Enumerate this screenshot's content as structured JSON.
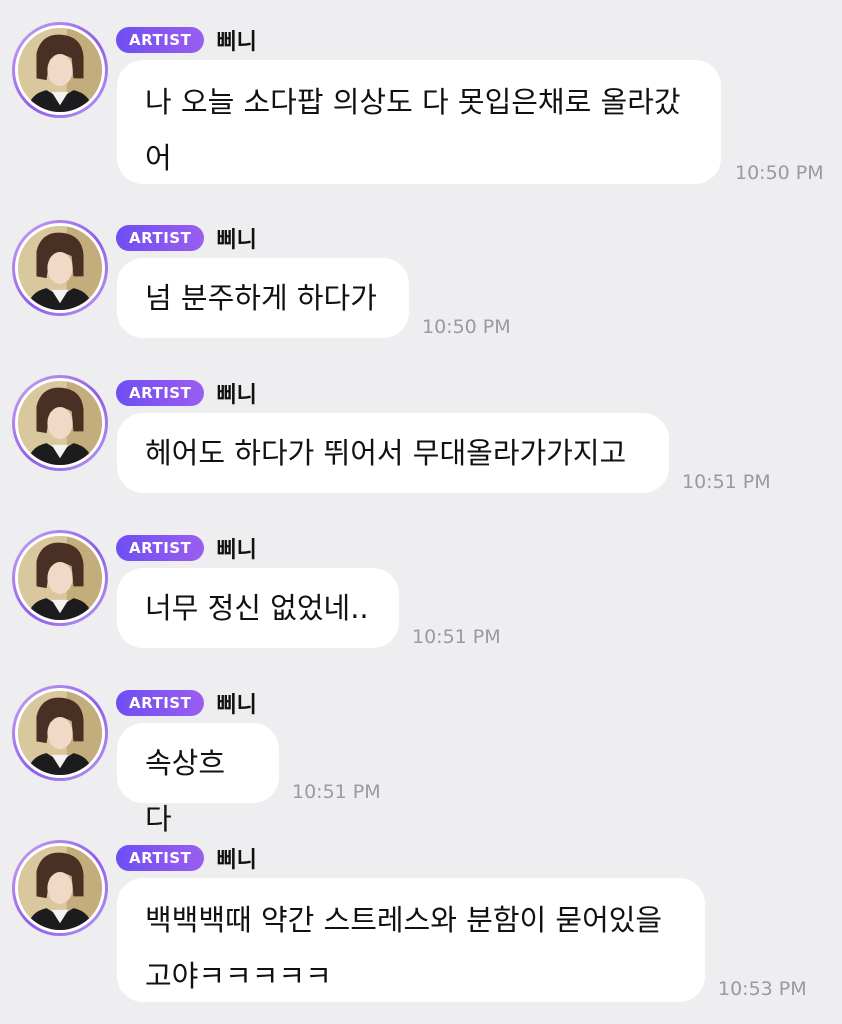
{
  "badge_label": "ARTIST",
  "sender_name": "삐니",
  "colors": {
    "background": "#eeeef0",
    "bubble": "#ffffff",
    "badge_gradient_start": "#6f4ef2",
    "badge_gradient_end": "#9a5ef0",
    "avatar_ring": "#8e5ce8",
    "timestamp": "#9a9aa0"
  },
  "messages": [
    {
      "lines": [
        "나 오늘 소다팝 의상도 다 못입은채로 올라갔",
        "어"
      ],
      "time": "10:50 PM"
    },
    {
      "lines": [
        "넘 분주하게 하다가"
      ],
      "time": "10:50 PM"
    },
    {
      "lines": [
        "헤어도 하다가 뛰어서 무대올라가가지고"
      ],
      "time": "10:51 PM"
    },
    {
      "lines": [
        "너무 정신 없었네.."
      ],
      "time": "10:51 PM"
    },
    {
      "lines": [
        "속상흐다"
      ],
      "time": "10:51 PM"
    },
    {
      "lines": [
        "백백백때 약간 스트레스와 분함이 묻어있을",
        "고야ㅋㅋㅋㅋㅋ"
      ],
      "time": "10:53 PM"
    }
  ]
}
